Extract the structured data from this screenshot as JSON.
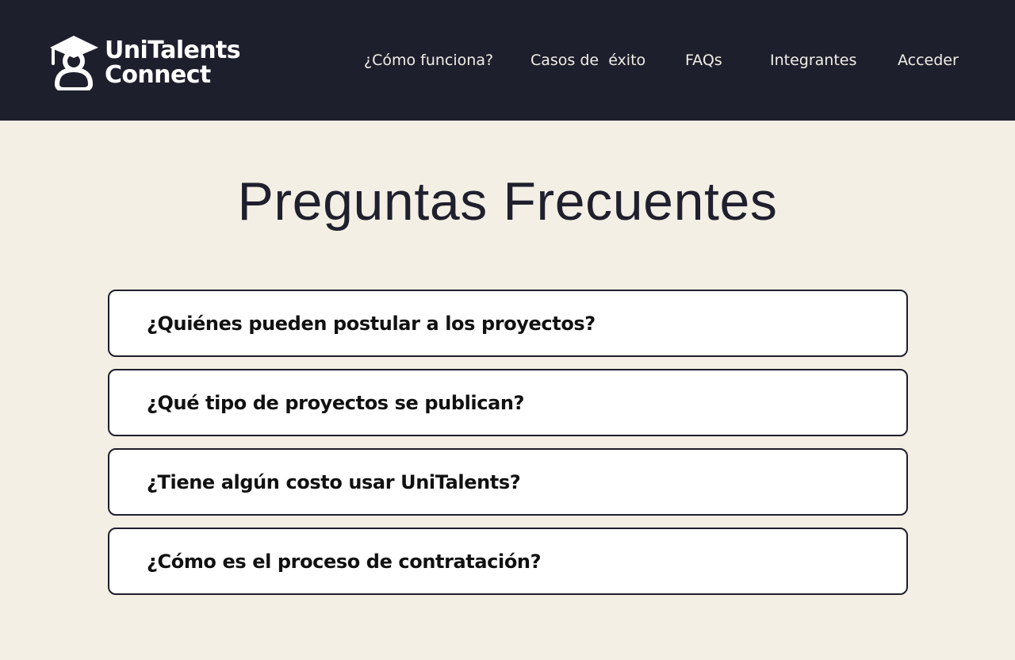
{
  "brand": {
    "name_line1": "UniTalents",
    "name_line2": "Connect",
    "logo_icon": "graduate-person-icon"
  },
  "nav": {
    "items": [
      {
        "label": "¿Cómo funciona?"
      },
      {
        "label": "Casos de  éxito"
      },
      {
        "label": "FAQs"
      },
      {
        "label": "Integrantes"
      },
      {
        "label": "Acceder"
      }
    ]
  },
  "main": {
    "title": "Preguntas Frecuentes",
    "faqs": [
      {
        "question": "¿Quiénes pueden postular a los proyectos?"
      },
      {
        "question": "¿Qué tipo de proyectos se publican?"
      },
      {
        "question": "¿Tiene algún costo usar UniTalents?"
      },
      {
        "question": "¿Cómo es el proceso de contratación?"
      }
    ]
  },
  "colors": {
    "header_bg": "#1e1f2c",
    "page_bg": "#f4efe4",
    "card_bg": "#ffffff",
    "card_border": "#1e1f2c",
    "title_text": "#1f1f2e",
    "nav_text": "#f1eee8"
  }
}
